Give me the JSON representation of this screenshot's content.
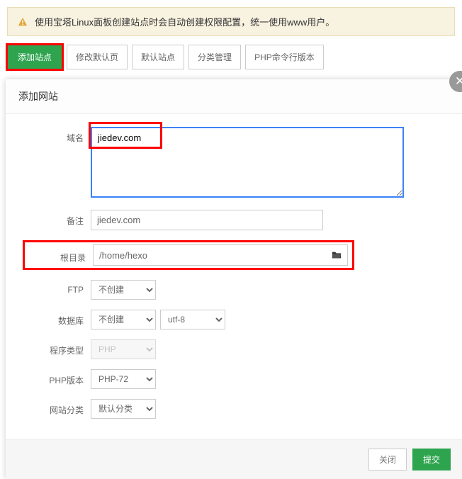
{
  "notice": {
    "text": "使用宝塔Linux面板创建站点时会自动创建权限配置，统一使用www用户。"
  },
  "tabs": {
    "add_site": "添加站点",
    "modify_default": "修改默认页",
    "default_site": "默认站点",
    "category_manage": "分类管理",
    "php_cli_version": "PHP命令行版本"
  },
  "dialog": {
    "title": "添加网站",
    "close_icon": "✕",
    "labels": {
      "domain": "域名",
      "remark": "备注",
      "root_dir": "根目录",
      "ftp": "FTP",
      "database": "数据库",
      "program_type": "程序类型",
      "php_version": "PHP版本",
      "site_category": "网站分类"
    },
    "values": {
      "domain": "jiedev.com",
      "remark": "jiedev.com",
      "root_dir": "/home/hexo",
      "ftp": "不创建",
      "database": "不创建",
      "charset": "utf-8",
      "program_type": "PHP",
      "php_version": "PHP-72",
      "site_category": "默认分类"
    },
    "footer": {
      "cancel": "关闭",
      "submit": "提交"
    }
  }
}
